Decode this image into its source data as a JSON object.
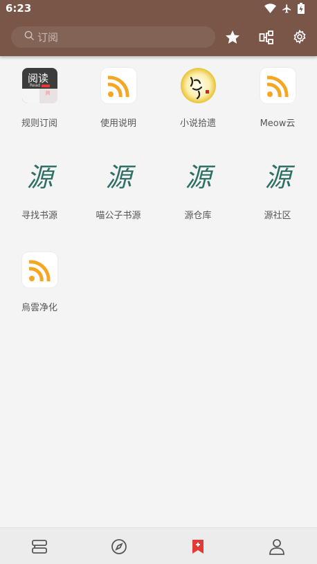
{
  "status": {
    "time": "6:23",
    "icons": [
      "wifi-icon",
      "airplane-icon",
      "battery-charging-icon"
    ]
  },
  "toolbar": {
    "search_placeholder": "订阅",
    "icons": [
      "star-icon",
      "group-icon",
      "settings-icon"
    ]
  },
  "subscriptions": [
    {
      "label": "规则订阅",
      "icon": "reader-app-icon"
    },
    {
      "label": "使用说明",
      "icon": "rss-icon"
    },
    {
      "label": "小说拾遗",
      "icon": "novel-seal-icon"
    },
    {
      "label": "Meow云",
      "icon": "rss-icon"
    },
    {
      "label": "寻找书源",
      "icon": "yuan-calligraphy-icon"
    },
    {
      "label": "喵公子书源",
      "icon": "yuan-calligraphy-icon"
    },
    {
      "label": "源仓库",
      "icon": "yuan-calligraphy-icon"
    },
    {
      "label": "源社区",
      "icon": "yuan-calligraphy-icon"
    },
    {
      "label": "烏雲净化",
      "icon": "rss-icon"
    }
  ],
  "reader_logo_text": {
    "main": "阅读",
    "sub": "Read"
  },
  "yuan_char": "源",
  "seal_text": "小说",
  "bottom_nav": [
    "bookshelf-icon",
    "explore-icon",
    "subscription-icon",
    "profile-icon"
  ],
  "colors": {
    "toolbar": "#7a5649",
    "accent": "#e53935",
    "rss_orange": "#f5a623",
    "yuan_green": "#2f6f66"
  }
}
